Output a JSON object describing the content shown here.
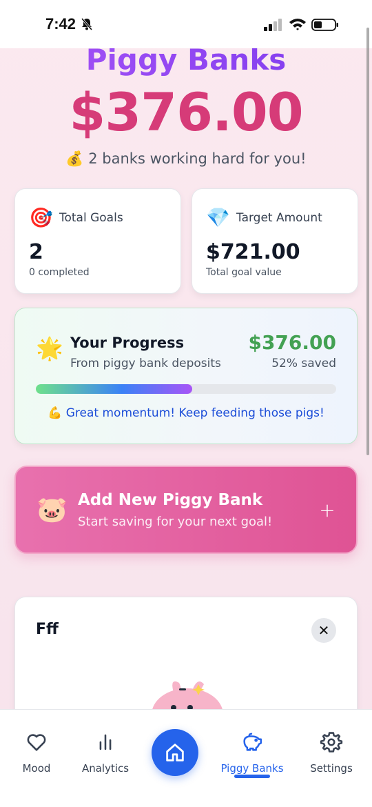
{
  "status_bar": {
    "time": "7:42"
  },
  "header": {
    "title": "Piggy Banks",
    "total": "$376.00",
    "tagline_emoji": "💰",
    "tagline": "2 banks working hard for you!"
  },
  "stats": [
    {
      "emoji": "🎯",
      "label": "Total Goals",
      "value": "2",
      "sub": "0 completed"
    },
    {
      "emoji": "💎",
      "label": "Target Amount",
      "value": "$721.00",
      "sub": "Total goal value"
    }
  ],
  "progress": {
    "emoji": "🌟",
    "title": "Your Progress",
    "subtitle": "From piggy bank deposits",
    "amount": "$376.00",
    "percent_label": "52% saved",
    "percent": 52,
    "message": "💪 Great momentum! Keep feeding those pigs!"
  },
  "add_bank": {
    "emoji": "🐷",
    "title": "Add New Piggy Bank",
    "subtitle": "Start saving for your next goal!",
    "plus": "+"
  },
  "bank": {
    "name": "Fff",
    "close": "✕"
  },
  "nav": {
    "items": [
      {
        "label": "Mood",
        "icon": "heart-icon"
      },
      {
        "label": "Analytics",
        "icon": "bar-chart-icon"
      },
      {
        "label": "",
        "icon": "home-icon"
      },
      {
        "label": "Piggy Banks",
        "icon": "piggy-bank-icon",
        "active": true
      },
      {
        "label": "Settings",
        "icon": "gear-icon"
      }
    ]
  },
  "colors": {
    "accent": "#2563eb",
    "amount": "#d63b78",
    "success": "#43a153",
    "add_card": "#df5394"
  }
}
